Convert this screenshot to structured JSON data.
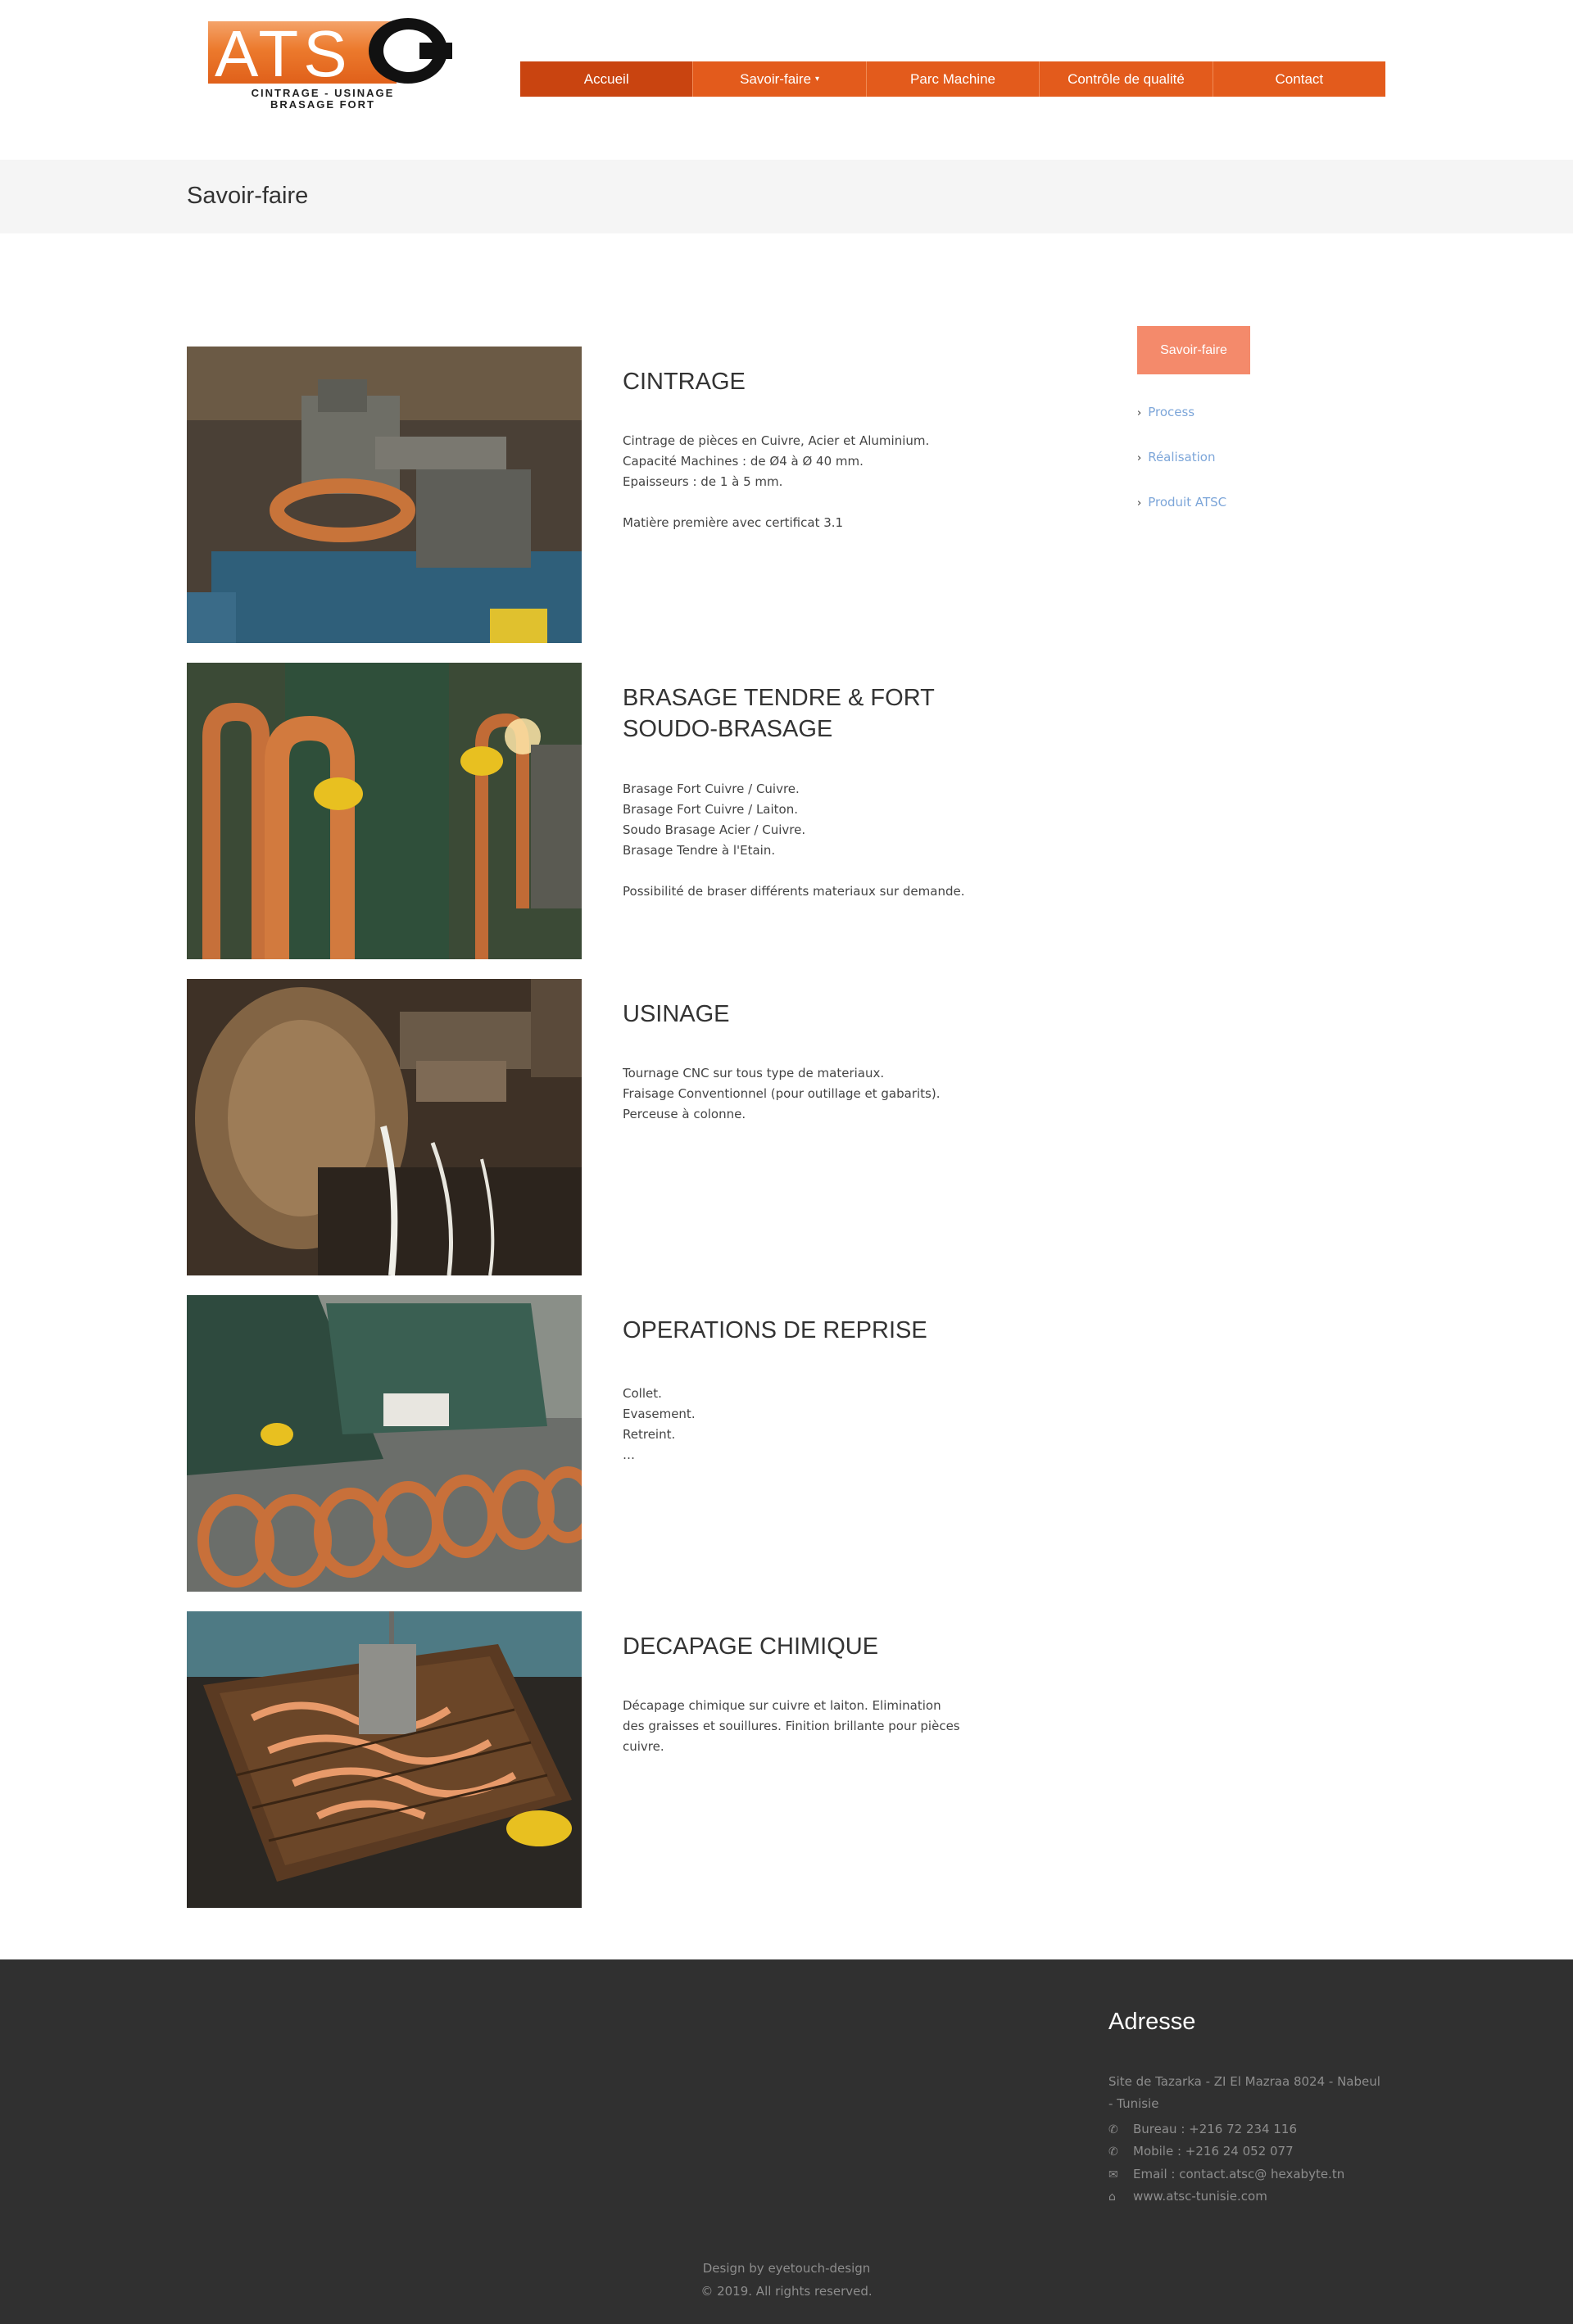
{
  "brand": {
    "logo_letters": "ATS",
    "logo_tagline_1": "CINTRAGE - USINAGE",
    "logo_tagline_2": "BRASAGE FORT"
  },
  "nav": {
    "items": [
      {
        "label": "Accueil",
        "active": true
      },
      {
        "label": "Savoir-faire",
        "has_dropdown": true
      },
      {
        "label": "Parc Machine"
      },
      {
        "label": "Contrôle de qualité"
      },
      {
        "label": "Contact"
      }
    ]
  },
  "page": {
    "title": "Savoir-faire"
  },
  "sections": [
    {
      "title": "CINTRAGE",
      "lines": [
        "Cintrage de pièces en Cuivre, Acier et Aluminium.",
        "Capacité Machines : de Ø4 à Ø 40 mm.",
        "Epaisseurs : de 1 à 5 mm.",
        "",
        "Matière première avec certificat 3.1"
      ]
    },
    {
      "title": "BRASAGE TENDRE & FORT SOUDO-BRASAGE",
      "lines": [
        "Brasage Fort Cuivre / Cuivre.",
        "Brasage Fort Cuivre / Laiton.",
        "Soudo Brasage Acier / Cuivre.",
        "Brasage Tendre à l'Etain.",
        "",
        "Possibilité de braser différents materiaux sur demande."
      ]
    },
    {
      "title": "USINAGE",
      "lines": [
        "Tournage CNC sur tous type de materiaux.",
        "Fraisage Conventionnel (pour outillage et gabarits).",
        "Perceuse à colonne."
      ]
    },
    {
      "title": "OPERATIONS DE REPRISE",
      "lines": [
        "Collet.",
        "Evasement.",
        "Retreint.",
        "…"
      ]
    },
    {
      "title": "DECAPAGE CHIMIQUE",
      "lines": [
        "Décapage chimique sur cuivre et laiton. Elimination",
        "des graisses et souillures. Finition brillante pour pièces",
        "cuivre."
      ]
    }
  ],
  "sidebar": {
    "button_label": "Savoir-faire",
    "links": [
      "Process",
      "Réalisation",
      "Produit ATSC"
    ]
  },
  "footer": {
    "heading": "Adresse",
    "address": "Site de Tazarka - ZI El Mazraa 8024 - Nabeul - Tunisie",
    "bureau": "Bureau : +216 72 234 116",
    "mobile": "Mobile : +216 24 052 077",
    "email": "Email : contact.atsc@ hexabyte.tn",
    "website": "www.atsc-tunisie.com",
    "design_credit": "Design by eyetouch-design",
    "copyright": "© 2019. All rights reserved."
  },
  "colors": {
    "nav_bg": "#e35b1c",
    "nav_active": "#c94410",
    "sidebar_button": "#f48a6b",
    "link": "#7da6d9",
    "footer_bg": "#303030"
  }
}
